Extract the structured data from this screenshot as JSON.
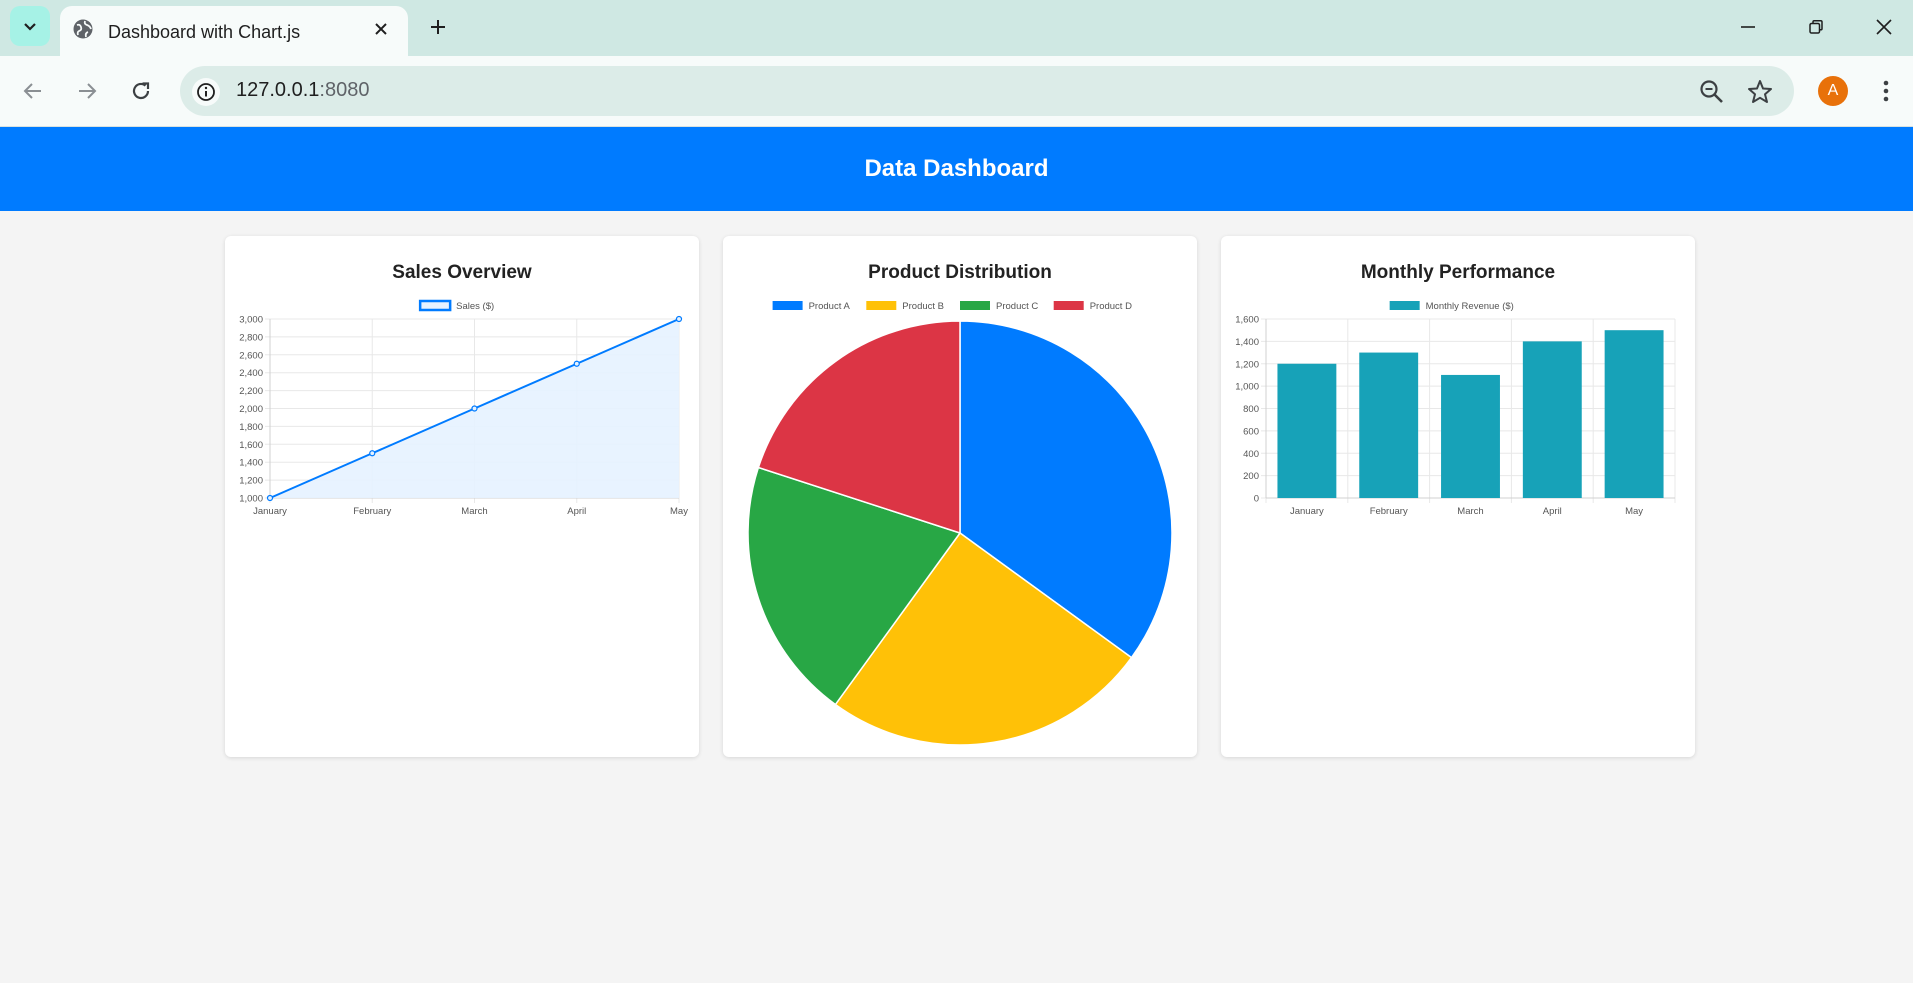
{
  "browser": {
    "tab_title": "Dashboard with Chart.js",
    "url_host": "127.0.0.1",
    "url_port": ":8080",
    "avatar_letter": "A",
    "icons": [
      "tab-list-icon",
      "globe-icon",
      "close-icon",
      "plus-icon",
      "minimize-icon",
      "restore-icon",
      "window-close-icon",
      "back-icon",
      "forward-icon",
      "reload-icon",
      "info-icon",
      "zoom-icon",
      "star-icon",
      "more-icon"
    ]
  },
  "page": {
    "title": "Data Dashboard",
    "colors": {
      "header": "#007bff",
      "background": "#f4f4f4"
    }
  },
  "cards": [
    {
      "title": "Sales Overview"
    },
    {
      "title": "Product Distribution"
    },
    {
      "title": "Monthly Performance"
    }
  ],
  "chart_data": [
    {
      "type": "line",
      "title": "Sales Overview",
      "categories": [
        "January",
        "February",
        "March",
        "April",
        "May"
      ],
      "series": [
        {
          "name": "Sales ($)",
          "values": [
            1000,
            1500,
            2000,
            2500,
            3000
          ],
          "color": "#007bff",
          "fill": "#e6f2ff"
        }
      ],
      "ylim": [
        1000,
        3000
      ],
      "yticks": [
        "1,000",
        "1,200",
        "1,400",
        "1,600",
        "1,800",
        "2,000",
        "2,200",
        "2,400",
        "2,600",
        "2,800",
        "3,000"
      ],
      "legend": "top",
      "grid": true
    },
    {
      "type": "pie",
      "title": "Product Distribution",
      "categories": [
        "Product A",
        "Product B",
        "Product C",
        "Product D"
      ],
      "values": [
        35,
        25,
        20,
        20
      ],
      "colors": [
        "#007bff",
        "#ffc107",
        "#28a745",
        "#dc3545"
      ],
      "legend": "top"
    },
    {
      "type": "bar",
      "title": "Monthly Performance",
      "categories": [
        "January",
        "February",
        "March",
        "April",
        "May"
      ],
      "series": [
        {
          "name": "Monthly Revenue ($)",
          "values": [
            1200,
            1300,
            1100,
            1400,
            1500
          ],
          "color": "#17a2b8"
        }
      ],
      "ylim": [
        0,
        1600
      ],
      "yticks": [
        "0",
        "200",
        "400",
        "600",
        "800",
        "1,000",
        "1,200",
        "1,400",
        "1,600"
      ],
      "legend": "top",
      "grid": true
    }
  ]
}
